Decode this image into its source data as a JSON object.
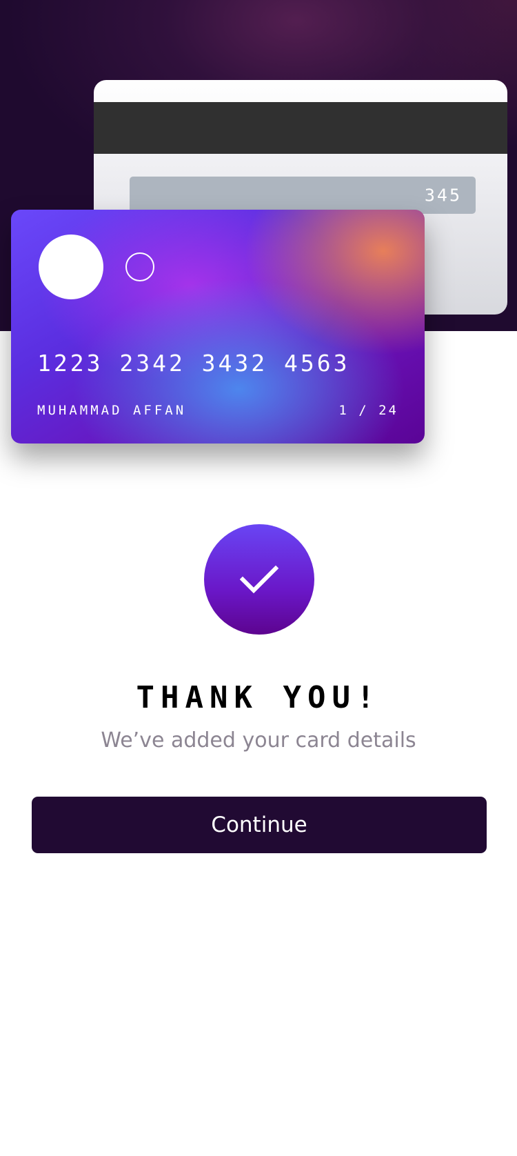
{
  "card_back": {
    "cvc": "345"
  },
  "card_front": {
    "number": "1223 2342 3432 4563",
    "holder_name": "MUHAMMAD AFFAN",
    "expiry": "1 / 24"
  },
  "success": {
    "icon": "checkmark-icon",
    "title": "THANK YOU!",
    "subtitle": "We’ve added your card details"
  },
  "actions": {
    "continue_label": "Continue"
  },
  "colors": {
    "hero_background": "#1f0a2f",
    "accent_purple": "#6a17c8",
    "button_background": "#210a33",
    "subtitle_text": "#8c8592"
  }
}
